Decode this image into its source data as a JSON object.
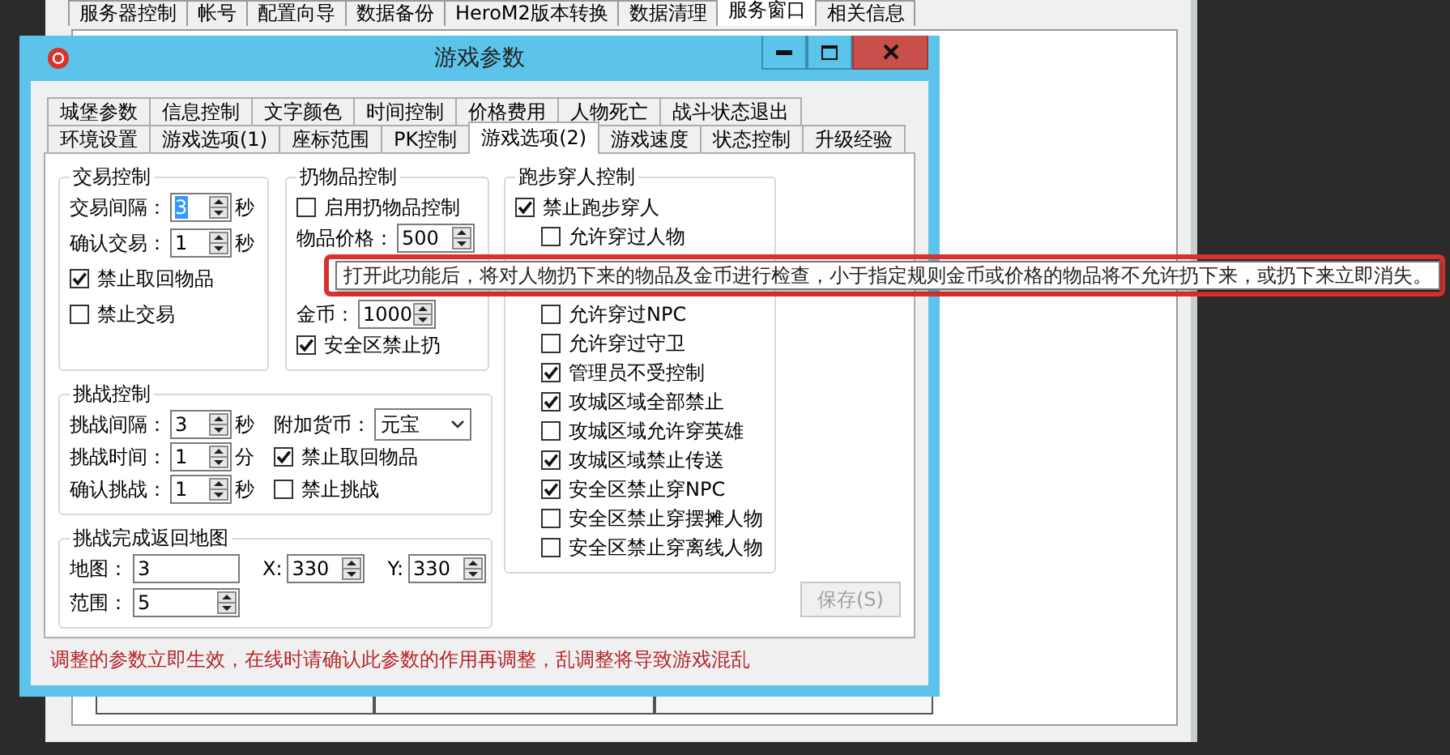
{
  "host_window": {
    "tabs": [
      {
        "label": "服务器控制",
        "selected": false
      },
      {
        "label": "帐号",
        "selected": false
      },
      {
        "label": "配置向导",
        "selected": false
      },
      {
        "label": "数据备份",
        "selected": false
      },
      {
        "label": "HeroM2版本转换",
        "selected": false
      },
      {
        "label": "数据清理",
        "selected": false
      },
      {
        "label": "服务窗口",
        "selected": true
      },
      {
        "label": "相关信息",
        "selected": false
      }
    ]
  },
  "dialog": {
    "title": "游戏参数",
    "tab_rows": [
      [
        {
          "label": "城堡参数",
          "selected": false
        },
        {
          "label": "信息控制",
          "selected": false
        },
        {
          "label": "文字颜色",
          "selected": false
        },
        {
          "label": "时间控制",
          "selected": false
        },
        {
          "label": "价格费用",
          "selected": false
        },
        {
          "label": "人物死亡",
          "selected": false
        },
        {
          "label": "战斗状态退出",
          "selected": false
        }
      ],
      [
        {
          "label": "环境设置",
          "selected": false
        },
        {
          "label": "游戏选项(1)",
          "selected": false
        },
        {
          "label": "座标范围",
          "selected": false
        },
        {
          "label": "PK控制",
          "selected": false
        },
        {
          "label": "游戏选项(2)",
          "selected": true
        },
        {
          "label": "游戏速度",
          "selected": false
        },
        {
          "label": "状态控制",
          "selected": false
        },
        {
          "label": "升级经验",
          "selected": false
        }
      ]
    ],
    "trade_group": {
      "title": "交易控制",
      "rows": [
        {
          "kind": "spin",
          "label": "交易间隔：",
          "value": "3",
          "unit": "秒",
          "focused": true
        },
        {
          "kind": "spin",
          "label": "确认交易：",
          "value": "1",
          "unit": "秒",
          "focused": false
        },
        {
          "kind": "check",
          "label": "禁止取回物品",
          "checked": true
        },
        {
          "kind": "check",
          "label": "禁止交易",
          "checked": false
        }
      ]
    },
    "drop_group": {
      "title": "扔物品控制",
      "rows": [
        {
          "kind": "check",
          "label": "启用扔物品控制",
          "checked": false
        },
        {
          "kind": "spin",
          "label": "物品价格：",
          "value": "500",
          "focused": false
        },
        {
          "kind": "spin",
          "label": "金币：",
          "value": "1000",
          "focused": false
        },
        {
          "kind": "check",
          "label": "安全区禁止扔",
          "checked": true
        }
      ]
    },
    "challenge_group": {
      "title": "挑战控制",
      "left": [
        {
          "kind": "spin",
          "label": "挑战间隔：",
          "value": "3",
          "unit": "秒",
          "focused": false
        },
        {
          "kind": "spin",
          "label": "挑战时间：",
          "value": "1",
          "unit": "分",
          "focused": false
        },
        {
          "kind": "spin",
          "label": "确认挑战：",
          "value": "1",
          "unit": "秒",
          "focused": false
        }
      ],
      "right": [
        {
          "kind": "select",
          "label": "附加货币：",
          "value": "元宝"
        },
        {
          "kind": "check",
          "label": "禁止取回物品",
          "checked": true
        },
        {
          "kind": "check",
          "label": "禁止挑战",
          "checked": false
        }
      ]
    },
    "return_map_group": {
      "title": "挑战完成返回地图",
      "rows": [
        [
          {
            "kind": "text",
            "label": "地图：",
            "value": "3"
          },
          {
            "kind": "spin",
            "label": "X:",
            "value": "330",
            "focused": false
          },
          {
            "kind": "spin",
            "label": "Y:",
            "value": "330",
            "focused": false
          }
        ],
        [
          {
            "kind": "spin",
            "label": "范围：",
            "value": "5",
            "focused": false
          }
        ]
      ]
    },
    "run_group": {
      "title": "跑步穿人控制",
      "items": [
        {
          "label": "禁止跑步穿人",
          "checked": true,
          "children": [
            {
              "label": "允许穿过人物",
              "checked": false
            },
            {
              "label": "允许穿过NPC",
              "checked": false
            },
            {
              "label": "允许穿过守卫",
              "checked": false
            },
            {
              "label": "管理员不受控制",
              "checked": true
            },
            {
              "label": "攻城区域全部禁止",
              "checked": true
            },
            {
              "label": "攻城区域允许穿英雄",
              "checked": false
            },
            {
              "label": "攻城区域禁止传送",
              "checked": true
            },
            {
              "label": "安全区禁止穿NPC",
              "checked": true
            },
            {
              "label": "安全区禁止穿摆摊人物",
              "checked": false
            },
            {
              "label": "安全区禁止穿离线人物",
              "checked": false
            }
          ]
        }
      ]
    },
    "save_button": {
      "label": "保存(S)",
      "disabled": true
    },
    "footer_note": "调整的参数立即生效，在线时请确认此参数的作用再调整，乱调整将导致游戏混乱"
  },
  "tooltip": {
    "text": "打开此功能后，将对人物扔下来的物品及金币进行检查，小于指定规则金币或价格的物品将不允许扔下来，或扔下来立即消失。"
  }
}
